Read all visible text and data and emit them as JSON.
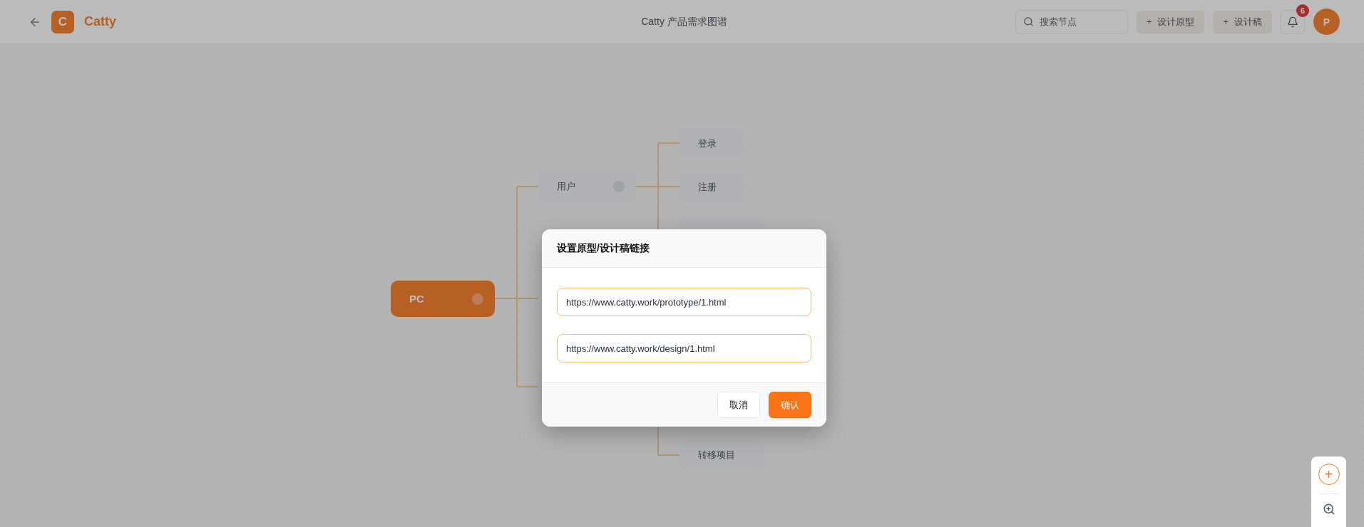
{
  "header": {
    "logo_letter": "C",
    "app_name": "Catty",
    "title": "Catty 产品需求图谱",
    "search": {
      "placeholder": "搜索节点"
    },
    "buttons": [
      {
        "icon": "+",
        "label": "设计原型"
      },
      {
        "icon": "+",
        "label": "设计稿"
      }
    ],
    "notification_count": "6",
    "avatar_letter": "P"
  },
  "mindmap": {
    "root": {
      "label": "PC"
    },
    "branches": [
      {
        "label": "用户",
        "children": [
          {
            "kind": "node",
            "label": "登录"
          },
          {
            "kind": "node",
            "label": "注册"
          },
          {
            "kind": "node"
          }
        ]
      },
      {
        "children": [
          {
            "kind": "node",
            "label": "转移项目"
          }
        ]
      }
    ]
  },
  "dialog": {
    "title": "设置原型/设计稿链接",
    "fields": [
      {
        "value": "https://www.catty.work/prototype/1.html"
      },
      {
        "value": "https://www.catty.work/design/1.html"
      }
    ],
    "buttons": [
      {
        "label": "取消",
        "kind": "secondary"
      },
      {
        "label": "确认",
        "kind": "primary"
      }
    ]
  },
  "zoom_panel": {
    "add_icon": "+"
  }
}
